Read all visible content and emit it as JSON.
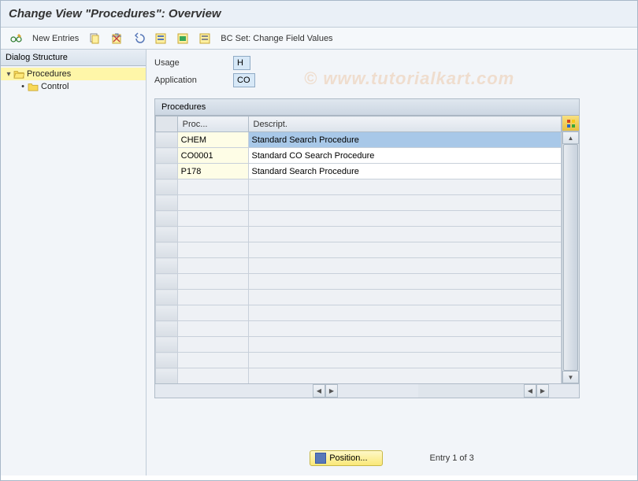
{
  "header": {
    "title": "Change View \"Procedures\": Overview"
  },
  "toolbar": {
    "new_entries": "New Entries",
    "bc_set": "BC Set: Change Field Values"
  },
  "sidebar": {
    "header": "Dialog Structure",
    "root": {
      "label": "Procedures"
    },
    "child": {
      "label": "Control"
    }
  },
  "form": {
    "usage_label": "Usage",
    "usage_value": "H",
    "application_label": "Application",
    "application_value": "CO"
  },
  "table": {
    "title": "Procedures",
    "columns": {
      "proc": "Proc...",
      "desc": "Descript."
    },
    "rows": [
      {
        "proc": "CHEM",
        "desc": "Standard Search Procedure",
        "selected": true
      },
      {
        "proc": "CO0001",
        "desc": "Standard CO Search Procedure",
        "selected": false
      },
      {
        "proc": "P178",
        "desc": "Standard Search Procedure",
        "selected": false
      }
    ]
  },
  "footer": {
    "position_label": "Position...",
    "entry_text": "Entry 1 of 3"
  },
  "watermark": "© www.tutorialkart.com"
}
